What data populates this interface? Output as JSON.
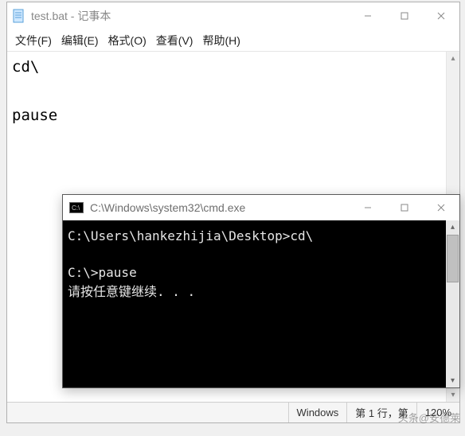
{
  "notepad": {
    "title": "test.bat - 记事本",
    "menu": {
      "file": "文件(F)",
      "edit": "编辑(E)",
      "format": "格式(O)",
      "view": "查看(V)",
      "help": "帮助(H)"
    },
    "content": "cd\\\n\npause",
    "status": {
      "os": "Windows",
      "position": "第 1 行，第",
      "zoom": "120%"
    }
  },
  "cmd": {
    "title": "C:\\Windows\\system32\\cmd.exe",
    "output": "C:\\Users\\hankezhijia\\Desktop>cd\\\n\nC:\\>pause\n请按任意键继续. . ."
  },
  "watermark": "头条@安德莱"
}
